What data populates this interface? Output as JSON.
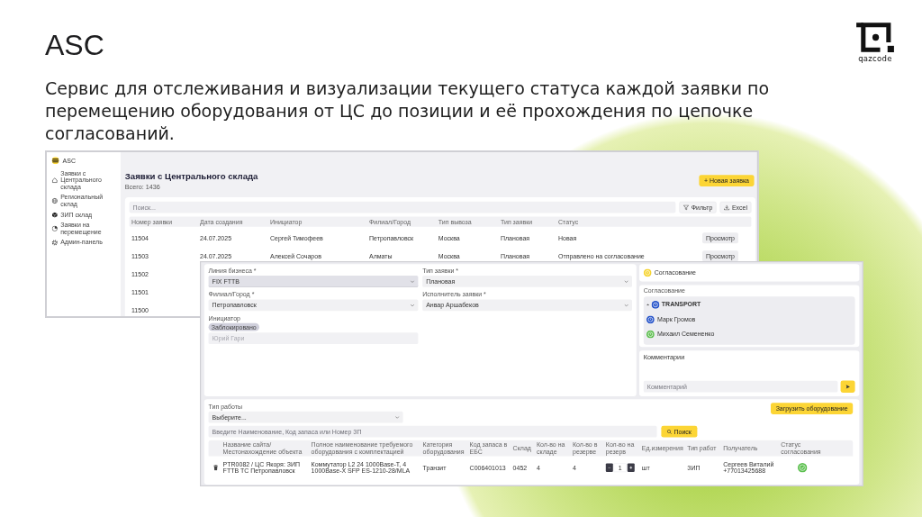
{
  "slide": {
    "title": "ASC",
    "description": "Сервис для отслеживания и визуализации текущего статуса каждой заявки по перемещению оборудования от ЦС до позиции и её прохождения по цепочке согласований.",
    "logo_text": "qazcode"
  },
  "requests_screen": {
    "sidebar": {
      "brand": "ASC",
      "items": [
        "Заявки с Центрального склада",
        "Региональный склад",
        "ЗИП склад",
        "Заявки на перемещение",
        "Админ-панель"
      ]
    },
    "title": "Заявки с Центрального склада",
    "total": "Всего: 1436",
    "new_button": "+ Новая заявка",
    "search": {
      "placeholder": "Поиск..."
    },
    "tools": [
      {
        "kind": "filter",
        "label": "Фильтр"
      },
      {
        "kind": "download",
        "label": "Excel"
      }
    ],
    "table": {
      "columns": [
        "Номер заявки",
        "Дата создания",
        "Инициатор",
        "Филиал/Город",
        "Тип вывоза",
        "Тип заявки",
        "Статус"
      ],
      "rows": [
        {
          "cells": [
            "11504",
            "24.07.2025",
            "Сергей Тимофеев",
            "Петропавловск",
            "Москва",
            "Плановая",
            "Новая"
          ],
          "action": "Просмотр"
        },
        {
          "cells": [
            "11503",
            "24.07.2025",
            "Алексей Сочаров",
            "Алматы",
            "Москва",
            "Плановая",
            "Отправлено на согласование"
          ],
          "action": "Просмотр"
        },
        {
          "cells": [
            "11502"
          ]
        },
        {
          "cells": [
            "11501"
          ]
        },
        {
          "cells": [
            "11500"
          ]
        }
      ]
    }
  },
  "form_screen": {
    "fields": [
      {
        "kind": "select",
        "label": "Линия бизнеса *",
        "value": "FIX FTTB",
        "focused": true
      },
      {
        "kind": "select",
        "label": "Тип заявки *",
        "value": "Плановая",
        "focused": false
      },
      {
        "kind": "select",
        "label": "Филиал/Город *",
        "value": "Петропавловск",
        "focused": false
      },
      {
        "kind": "select",
        "label": "Исполнитель заявки *",
        "value": "Анвар Аршабеков",
        "focused": false
      },
      {
        "kind": "text",
        "label": "Инициатор",
        "tag": "Заблокировано",
        "value": "Юрий Гари",
        "disabled": true
      }
    ],
    "approval_status": {
      "label": "Согласование",
      "approved": false
    },
    "approval_chain": {
      "title": "Согласование",
      "groups": [
        {
          "name": "TRANSPORT",
          "color": "#2251c9",
          "expanded": true,
          "children": [
            {
              "name": "Марк Громов",
              "color": "#2251c9"
            },
            {
              "name": "Михаил Семененко",
              "color": "#5dbf4f"
            }
          ]
        }
      ]
    },
    "comments": {
      "title": "Комментарии",
      "placeholder": "Комментарий"
    },
    "equipment": {
      "work_type": {
        "label": "Тип работы",
        "placeholder": "Выберите..."
      },
      "upload_button": "Загрузить оборудование",
      "search": {
        "placeholder": "Введите Наименование, Код запаса или Номер ЗП"
      },
      "search_button": "Поиск",
      "table": {
        "columns": [
          "Название сайта/ Местонахождение объекта",
          "Полное наименование требуемого оборудования с комплектацией",
          "Категория оборудования",
          "Код запаса в ЕБС",
          "Склад",
          "Кол-во на складе",
          "Кол-во в резерве",
          "Кол-во на резерв",
          "Ед.измерения",
          "Тип работ",
          "Получатель",
          "Статус согласования"
        ],
        "rows": [
          {
            "deletable": true,
            "cells": [
              {
                "kind": "text",
                "text": "PTR0082 / ЦС Якоря: ЗИП FTTB ТС Петропавловск"
              },
              {
                "kind": "text",
                "text": "Коммутатор L2 24 1000Base-T, 4 1000Base-X SFP ES-1210-28/MLA"
              },
              {
                "kind": "text",
                "text": "Транзит"
              },
              {
                "kind": "text",
                "text": "C006401013"
              },
              {
                "kind": "text",
                "text": "0452"
              },
              {
                "kind": "text",
                "text": "4"
              },
              {
                "kind": "text",
                "text": "4"
              },
              {
                "kind": "stepper",
                "value": "1"
              },
              {
                "kind": "text",
                "text": "шт"
              },
              {
                "kind": "text",
                "text": "ЗИП"
              },
              {
                "kind": "text",
                "text": "Сергеев Виталий\n+77013425688"
              },
              {
                "kind": "status",
                "approved": true
              }
            ]
          }
        ]
      }
    }
  }
}
